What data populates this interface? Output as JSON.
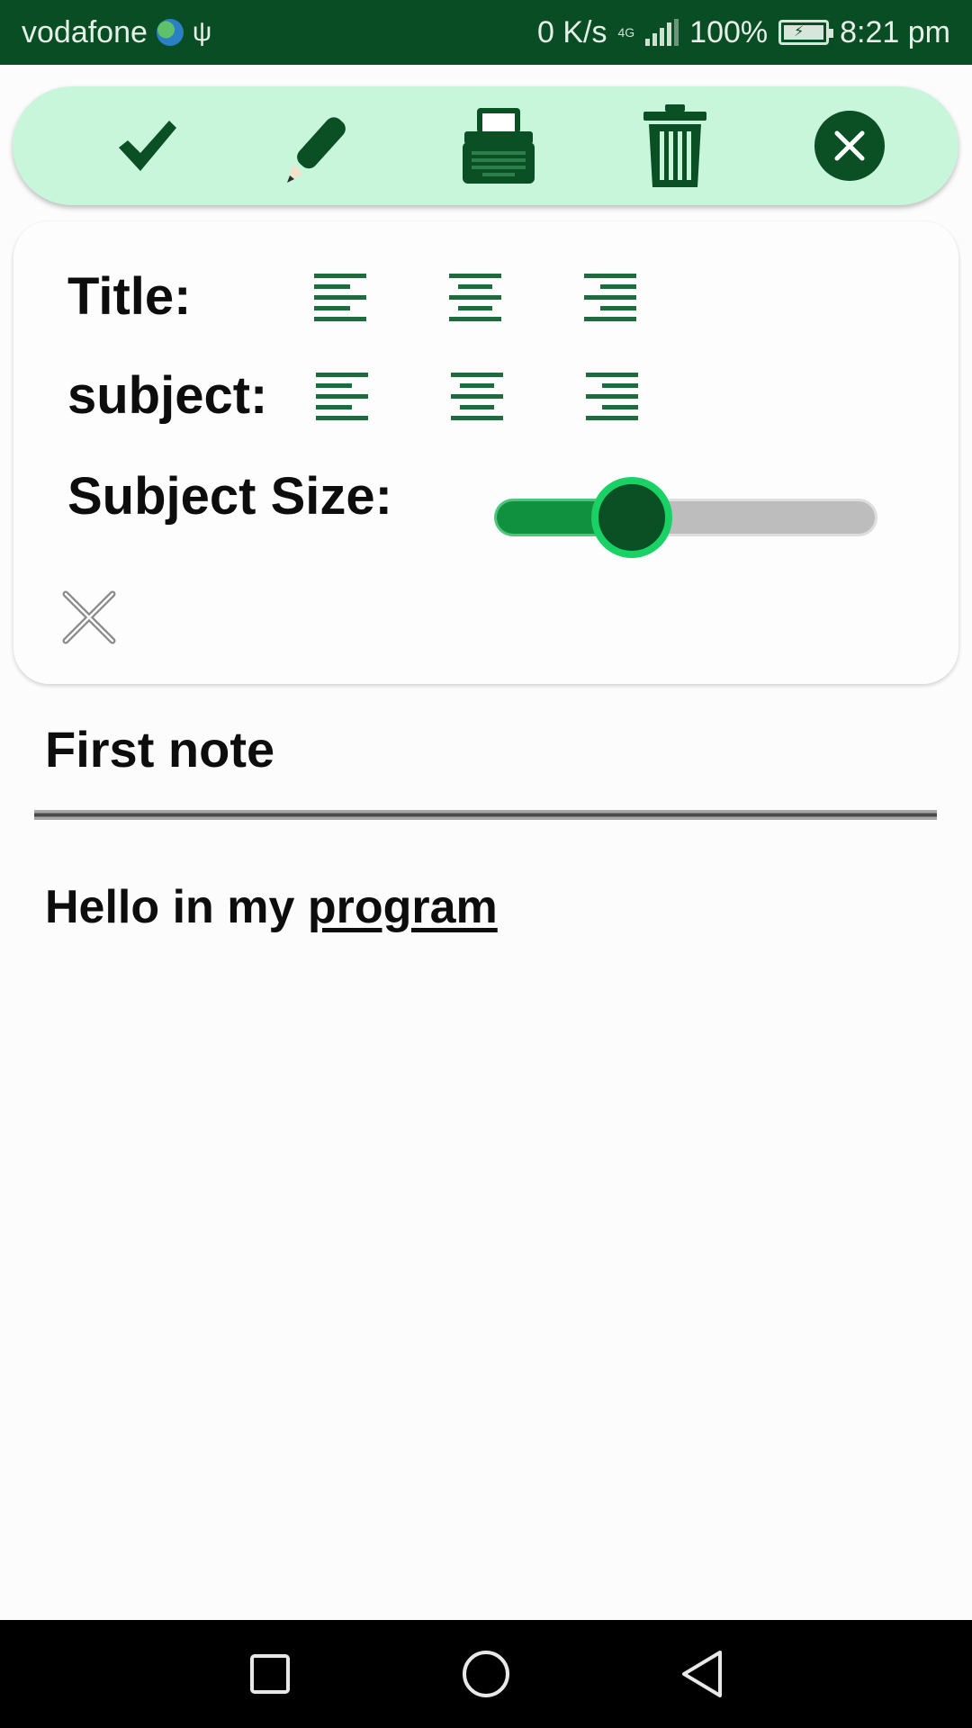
{
  "status_bar": {
    "carrier": "vodafone",
    "network_speed": "0 K/s",
    "network_type": "4G",
    "battery_percent": "100%",
    "time": "8:21 pm",
    "icons": [
      "globe-icon",
      "usb-icon",
      "signal-icon",
      "battery-charging-icon"
    ]
  },
  "toolbar": {
    "background": "#c7f6da",
    "icon_color": "#0b4f25",
    "buttons": [
      {
        "name": "save-button",
        "icon": "checkmark-icon"
      },
      {
        "name": "edit-button",
        "icon": "pencil-icon"
      },
      {
        "name": "typewriter-button",
        "icon": "typewriter-icon"
      },
      {
        "name": "delete-button",
        "icon": "trash-icon"
      },
      {
        "name": "close-button",
        "icon": "close-circle-icon"
      }
    ]
  },
  "format_panel": {
    "title_label": "Title:",
    "subject_label": "subject:",
    "subject_size_label": "Subject Size:",
    "alignment_icons": [
      "align-left-icon",
      "align-center-icon",
      "align-right-icon"
    ],
    "subject_size_level": 0.36,
    "accent_color": "#10913f",
    "close_icon": "close-x-icon"
  },
  "note": {
    "title": "First note",
    "body_plain": "Hello in my ",
    "body_link": "program"
  },
  "nav_bar": {
    "buttons": [
      "recent-apps-icon",
      "home-icon",
      "back-icon"
    ]
  }
}
